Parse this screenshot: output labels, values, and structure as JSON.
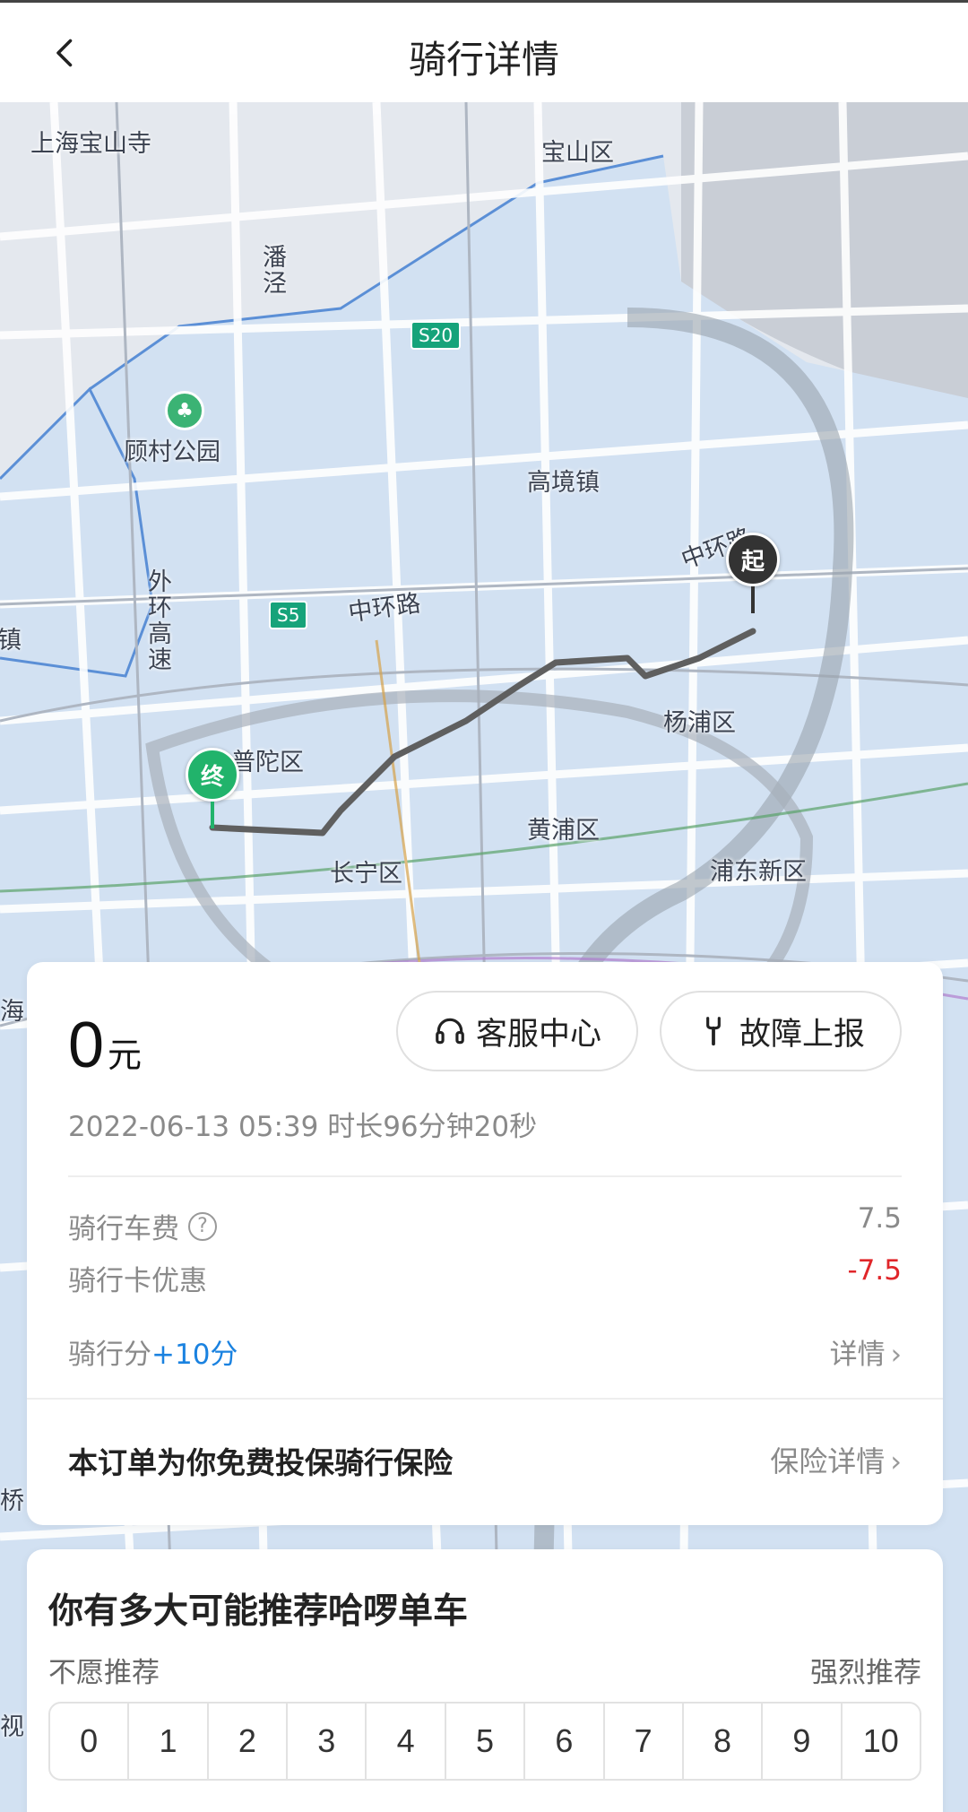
{
  "header": {
    "title": "骑行详情"
  },
  "map": {
    "labels": {
      "baoshan_temple": "上海宝山寺",
      "baoshan_district": "宝山区",
      "panjing": "潘泾",
      "gucun_park": "顾村公园",
      "gaojing": "高境镇",
      "zhonghuan_east": "中环路",
      "zhonghuan": "中环路",
      "waihuan": "外环高速",
      "zhen": "古镇",
      "yangpu": "杨浦区",
      "putuo": "普陀区",
      "huangpu": "黄浦区",
      "changning": "长宁区",
      "pudong": "浦东新区",
      "hai": "海",
      "qiao": "桥",
      "shi": "视"
    },
    "shields": {
      "s20": "S20",
      "s5": "S5"
    },
    "start_marker": "起",
    "end_marker": "终"
  },
  "trip": {
    "amount": "0",
    "unit": "元",
    "service_button": "客服中心",
    "fault_button": "故障上报",
    "meta": "2022-06-13 05:39  时长96分钟20秒",
    "fee_label": "骑行车费",
    "fee_value": "7.5",
    "discount_label": "骑行卡优惠",
    "discount_value": "-7.5",
    "points_label": "骑行分",
    "points_value": "+10分",
    "points_detail": "详情",
    "insurance_text": "本订单为你免费投保骑行保险",
    "insurance_link": "保险详情"
  },
  "nps": {
    "title": "你有多大可能推荐哈啰单车",
    "low_label": "不愿推荐",
    "high_label": "强烈推荐",
    "scores": [
      "0",
      "1",
      "2",
      "3",
      "4",
      "5",
      "6",
      "7",
      "8",
      "9",
      "10"
    ]
  },
  "colors": {
    "map_district": "#d2e1f2",
    "route": "#5f5f5f",
    "start_pin": "#333333",
    "end_pin": "#21b36b",
    "discount": "#e0262a",
    "points": "#1a82e0"
  }
}
